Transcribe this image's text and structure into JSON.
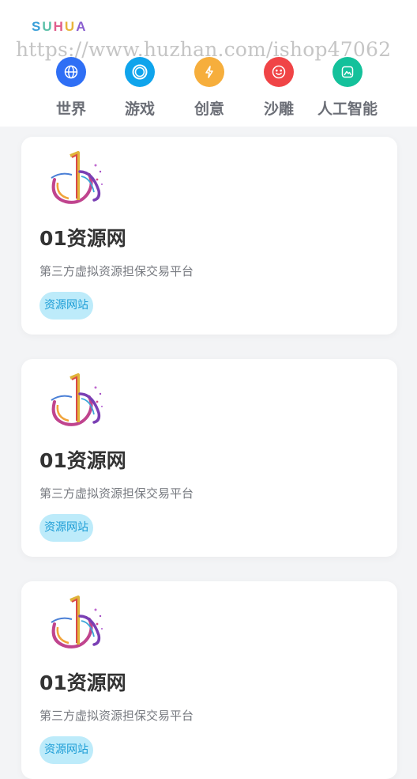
{
  "header": {
    "logo_letters": [
      "S",
      "U",
      "H",
      "U",
      "A"
    ],
    "logo_colors": [
      "#3a9fd8",
      "#5bc0a8",
      "#e05d8c",
      "#e8b43a",
      "#8a5fd0"
    ],
    "watermark": "https://www.huzhan.com/ishop47062"
  },
  "categories": [
    {
      "label": "世界",
      "icon": "globe-icon",
      "color": "#2f6ff5"
    },
    {
      "label": "游戏",
      "icon": "ring-icon",
      "color": "#0fa4ec"
    },
    {
      "label": "创意",
      "icon": "lightning-icon",
      "color": "#f6ae3c"
    },
    {
      "label": "沙雕",
      "icon": "smiley-icon",
      "color": "#f04446"
    },
    {
      "label": "人工智能",
      "icon": "image-icon",
      "color": "#14c19b"
    }
  ],
  "cards": [
    {
      "title": "01资源网",
      "desc": "第三方虚拟资源担保交易平台",
      "tag": "资源网站"
    },
    {
      "title": "01资源网",
      "desc": "第三方虚拟资源担保交易平台",
      "tag": "资源网站"
    },
    {
      "title": "01资源网",
      "desc": "第三方虚拟资源担保交易平台",
      "tag": "资源网站"
    }
  ]
}
